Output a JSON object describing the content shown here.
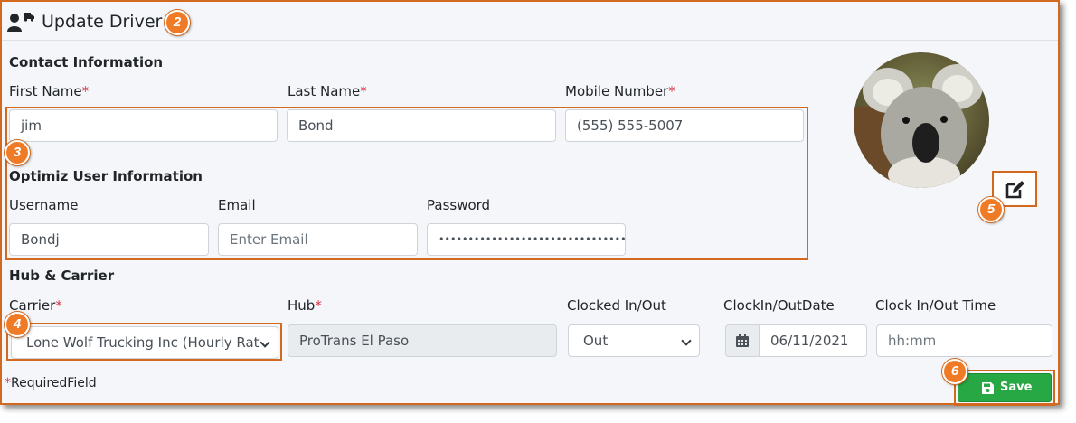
{
  "header": {
    "title": "Update Driver",
    "icon": "user-truck-icon"
  },
  "callouts": [
    "2",
    "3",
    "4",
    "5",
    "6"
  ],
  "contact": {
    "section_title": "Contact Information",
    "first_name_label": "First Name",
    "first_name_value": "jim",
    "last_name_label": "Last Name",
    "last_name_value": "Bond",
    "mobile_label": "Mobile Number",
    "mobile_value": "(555) 555-5007"
  },
  "user": {
    "section_title": "Optimiz User Information",
    "username_label": "Username",
    "username_value": "Bondj",
    "email_label": "Email",
    "email_placeholder": "Enter Email",
    "password_label": "Password",
    "password_value": "••••••••••••••••••••••••••••••••"
  },
  "hub": {
    "section_title": "Hub & Carrier",
    "carrier_label": "Carrier",
    "carrier_value": "Lone Wolf Trucking Inc (Hourly Rat",
    "hub_label": "Hub",
    "hub_value": "ProTrans El Paso",
    "clocked_label": "Clocked In/Out",
    "clocked_value": "Out",
    "date_label": "ClockIn/OutDate",
    "date_value": "06/11/2021",
    "time_label": "Clock In/Out Time",
    "time_placeholder": "hh:mm"
  },
  "required_asterisk": "*",
  "required_note": "RequiredField",
  "save_label": "Save",
  "colors": {
    "accent": "#d2691e",
    "callout": "#f07b26",
    "save": "#28a745",
    "required": "#dc3545"
  }
}
